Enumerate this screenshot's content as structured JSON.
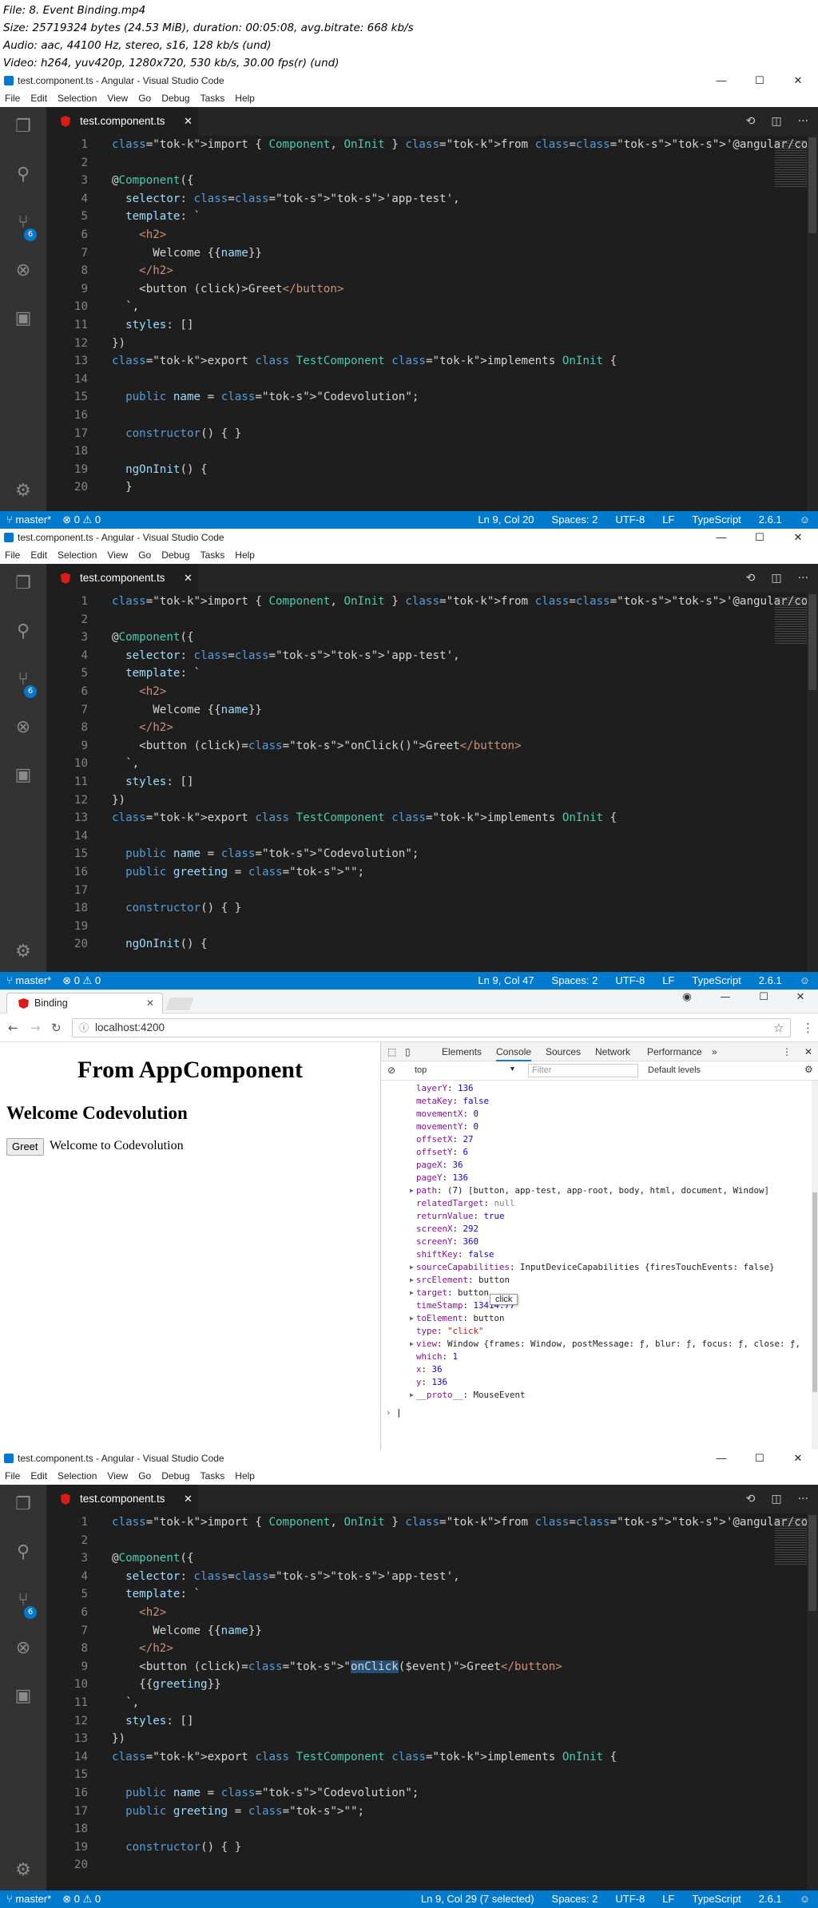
{
  "file_info": {
    "line1": "File: 8. Event Binding.mp4",
    "line2": "Size: 25719324 bytes (24.53 MiB), duration: 00:05:08, avg.bitrate: 668 kb/s",
    "line3": "Audio: aac, 44100 Hz, stereo, s16, 128 kb/s (und)",
    "line4": "Video: h264, yuv420p, 1280x720, 530 kb/s, 30.00 fps(r) (und)"
  },
  "vscode": {
    "title": "test.component.ts - Angular - Visual Studio Code",
    "menu": [
      "File",
      "Edit",
      "Selection",
      "View",
      "Go",
      "Debug",
      "Tasks",
      "Help"
    ],
    "tab_label": "test.component.ts",
    "scm_badge": "6",
    "branch": "master*",
    "errors": "0",
    "warnings": "0",
    "spaces": "Spaces: 2",
    "encoding": "UTF-8",
    "eol": "LF",
    "language": "TypeScript",
    "version": "2.6.1",
    "frames": [
      {
        "cursor": "Ln 9, Col 20",
        "lines": [
          {
            "n": "1",
            "text": "import { Component, OnInit } from '@angular/core';"
          },
          {
            "n": "2",
            "text": ""
          },
          {
            "n": "3",
            "text": "@Component({"
          },
          {
            "n": "4",
            "text": "  selector: 'app-test',"
          },
          {
            "n": "5",
            "text": "  template: `"
          },
          {
            "n": "6",
            "text": "    <h2>"
          },
          {
            "n": "7",
            "text": "      Welcome {{name}}"
          },
          {
            "n": "8",
            "text": "    </h2>"
          },
          {
            "n": "9",
            "text": "    <button (click)>Greet</button>"
          },
          {
            "n": "10",
            "text": "  `,"
          },
          {
            "n": "11",
            "text": "  styles: []"
          },
          {
            "n": "12",
            "text": "})"
          },
          {
            "n": "13",
            "text": "export class TestComponent implements OnInit {"
          },
          {
            "n": "14",
            "text": ""
          },
          {
            "n": "15",
            "text": "  public name = \"Codevolution\";"
          },
          {
            "n": "16",
            "text": ""
          },
          {
            "n": "17",
            "text": "  constructor() { }"
          },
          {
            "n": "18",
            "text": ""
          },
          {
            "n": "19",
            "text": "  ngOnInit() {"
          },
          {
            "n": "20",
            "text": "  }"
          }
        ]
      },
      {
        "cursor": "Ln 9, Col 47",
        "lines": [
          {
            "n": "1",
            "text": "import { Component, OnInit } from '@angular/core';"
          },
          {
            "n": "2",
            "text": ""
          },
          {
            "n": "3",
            "text": "@Component({"
          },
          {
            "n": "4",
            "text": "  selector: 'app-test',"
          },
          {
            "n": "5",
            "text": "  template: `"
          },
          {
            "n": "6",
            "text": "    <h2>"
          },
          {
            "n": "7",
            "text": "      Welcome {{name}}"
          },
          {
            "n": "8",
            "text": "    </h2>"
          },
          {
            "n": "9",
            "text": "    <button (click)=\"onClick()\">Greet</button>"
          },
          {
            "n": "10",
            "text": "  `,"
          },
          {
            "n": "11",
            "text": "  styles: []"
          },
          {
            "n": "12",
            "text": "})"
          },
          {
            "n": "13",
            "text": "export class TestComponent implements OnInit {"
          },
          {
            "n": "14",
            "text": ""
          },
          {
            "n": "15",
            "text": "  public name = \"Codevolution\";"
          },
          {
            "n": "16",
            "text": "  public greeting = \"\";"
          },
          {
            "n": "17",
            "text": ""
          },
          {
            "n": "18",
            "text": "  constructor() { }"
          },
          {
            "n": "19",
            "text": ""
          },
          {
            "n": "20",
            "text": "  ngOnInit() {"
          }
        ]
      },
      {
        "cursor": "Ln 9, Col 29 (7 selected)",
        "lines": [
          {
            "n": "1",
            "text": "import { Component, OnInit } from '@angular/core';"
          },
          {
            "n": "2",
            "text": ""
          },
          {
            "n": "3",
            "text": "@Component({"
          },
          {
            "n": "4",
            "text": "  selector: 'app-test',"
          },
          {
            "n": "5",
            "text": "  template: `"
          },
          {
            "n": "6",
            "text": "    <h2>"
          },
          {
            "n": "7",
            "text": "      Welcome {{name}}"
          },
          {
            "n": "8",
            "text": "    </h2>"
          },
          {
            "n": "9",
            "text": "    <button (click)=\"onClick($event)\">Greet</button>"
          },
          {
            "n": "10",
            "text": "    {{greeting}}"
          },
          {
            "n": "11",
            "text": "  `,"
          },
          {
            "n": "12",
            "text": "  styles: []"
          },
          {
            "n": "13",
            "text": "})"
          },
          {
            "n": "14",
            "text": "export class TestComponent implements OnInit {"
          },
          {
            "n": "15",
            "text": ""
          },
          {
            "n": "16",
            "text": "  public name = \"Codevolution\";"
          },
          {
            "n": "17",
            "text": "  public greeting = \"\";"
          },
          {
            "n": "18",
            "text": ""
          },
          {
            "n": "19",
            "text": "  constructor() { }"
          },
          {
            "n": "20",
            "text": ""
          }
        ]
      }
    ]
  },
  "chrome": {
    "tab_title": "Binding",
    "url": "localhost:4200",
    "page": {
      "heading": "From AppComponent",
      "subheading": "Welcome Codevolution",
      "button": "Greet",
      "message": "Welcome to Codevolution"
    },
    "devtools": {
      "tabs": [
        "Elements",
        "Console",
        "Sources",
        "Network",
        "Performance"
      ],
      "active_tab": "Console",
      "context": "top",
      "filter_placeholder": "Filter",
      "levels": "Default levels",
      "tooltip": "click",
      "console_lines": [
        {
          "k": "layerY",
          "v": "136",
          "t": "n"
        },
        {
          "k": "metaKey",
          "v": "false",
          "t": "n"
        },
        {
          "k": "movementX",
          "v": "0",
          "t": "n"
        },
        {
          "k": "movementY",
          "v": "0",
          "t": "n"
        },
        {
          "k": "offsetX",
          "v": "27",
          "t": "n"
        },
        {
          "k": "offsetY",
          "v": "6",
          "t": "n"
        },
        {
          "k": "pageX",
          "v": "36",
          "t": "n"
        },
        {
          "k": "pageY",
          "v": "136",
          "t": "n"
        },
        {
          "k": "path",
          "v": "(7) [button, app-test, app-root, body, html, document, Window]",
          "t": "o",
          "x": true
        },
        {
          "k": "relatedTarget",
          "v": "null",
          "t": "g"
        },
        {
          "k": "returnValue",
          "v": "true",
          "t": "n"
        },
        {
          "k": "screenX",
          "v": "292",
          "t": "n"
        },
        {
          "k": "screenY",
          "v": "360",
          "t": "n"
        },
        {
          "k": "shiftKey",
          "v": "false",
          "t": "n"
        },
        {
          "k": "sourceCapabilities",
          "v": "InputDeviceCapabilities {firesTouchEvents: false}",
          "t": "o",
          "x": true
        },
        {
          "k": "srcElement",
          "v": "button",
          "t": "o",
          "x": true
        },
        {
          "k": "target",
          "v": "button",
          "t": "o",
          "x": true
        },
        {
          "k": "timeStamp",
          "v": "13414.77",
          "t": "n"
        },
        {
          "k": "toElement",
          "v": "button",
          "t": "o",
          "x": true
        },
        {
          "k": "type",
          "v": "\"click\"",
          "t": "s"
        },
        {
          "k": "view",
          "v": "Window {frames: Window, postMessage: ƒ, blur: ƒ, focus: ƒ, close: ƒ,",
          "t": "o",
          "x": true
        },
        {
          "k": "which",
          "v": "1",
          "t": "n"
        },
        {
          "k": "x",
          "v": "36",
          "t": "n"
        },
        {
          "k": "y",
          "v": "136",
          "t": "n"
        },
        {
          "k": "__proto__",
          "v": "MouseEvent",
          "t": "o",
          "x": true
        }
      ]
    }
  }
}
